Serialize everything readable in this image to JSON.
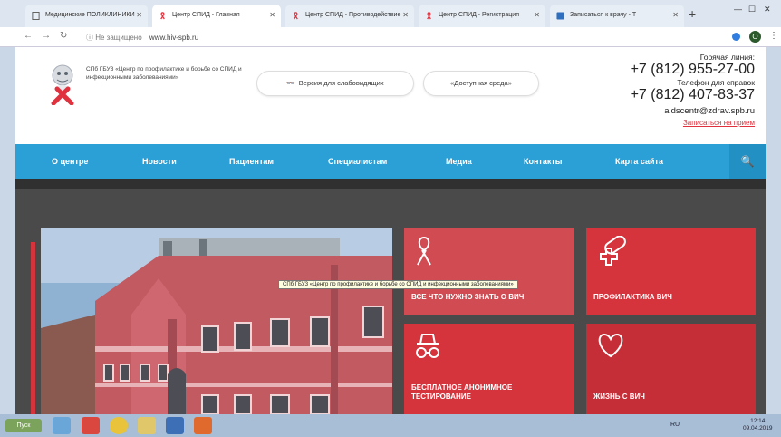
{
  "browser": {
    "tabs": [
      {
        "title": "Медицинские ПОЛИКЛИНИКИ",
        "active": false
      },
      {
        "title": "Центр СПИД - Главная",
        "active": true
      },
      {
        "title": "Центр СПИД - Противодействие",
        "active": false
      },
      {
        "title": "Центр СПИД - Регистрация",
        "active": false
      },
      {
        "title": "Записаться к врачу - Т",
        "active": false
      }
    ],
    "new_tab": "+",
    "address": {
      "security": "Не защищено",
      "url": "www.hiv-spb.ru"
    }
  },
  "site": {
    "org_name": "СПб ГБУЗ «Центр по профилактике и борьбе со СПИД и инфекционными заболеваниями»",
    "btn_low_vision": "Версия для слабовидящих",
    "btn_accessible": "«Доступная среда»",
    "hotline_label": "Горячая линия:",
    "hotline_phone": "+7 (812) 955-27-00",
    "info_label": "Телефон для справок",
    "info_phone": "+7 (812) 407-83-37",
    "email": "aidscentr@zdrav.spb.ru",
    "online_link": "Записаться на прием"
  },
  "menu": [
    "О центре",
    "Новости",
    "Пациентам",
    "Специалистам",
    "Медиа",
    "Контакты",
    "Карта сайта"
  ],
  "tiles": [
    {
      "label": "ВСЕ ЧТО НУЖНО ЗНАТЬ О ВИЧ",
      "icon": "ribbon-icon"
    },
    {
      "label": "ПРОФИЛАКТИКА ВИЧ",
      "icon": "pill-icon"
    },
    {
      "label": "БЕСПЛАТНОЕ АНОНИМНОЕ ТЕСТИРОВАНИЕ",
      "icon": "incognito-icon"
    },
    {
      "label": "ЖИЗНЬ С ВИЧ",
      "icon": "heart-icon"
    }
  ],
  "tooltip": "СПб ГБУЗ «Центр по профилактике и борьбе со СПИД и инфекционными заболеваниями»",
  "taskbar": {
    "start": "Пуск",
    "time": "12:14",
    "date": "09.04.2019",
    "lang": "RU"
  },
  "colors": {
    "accent_blue": "#2aa0d7",
    "accent_red": "#e0323e",
    "tile_red": "#d6343d"
  }
}
